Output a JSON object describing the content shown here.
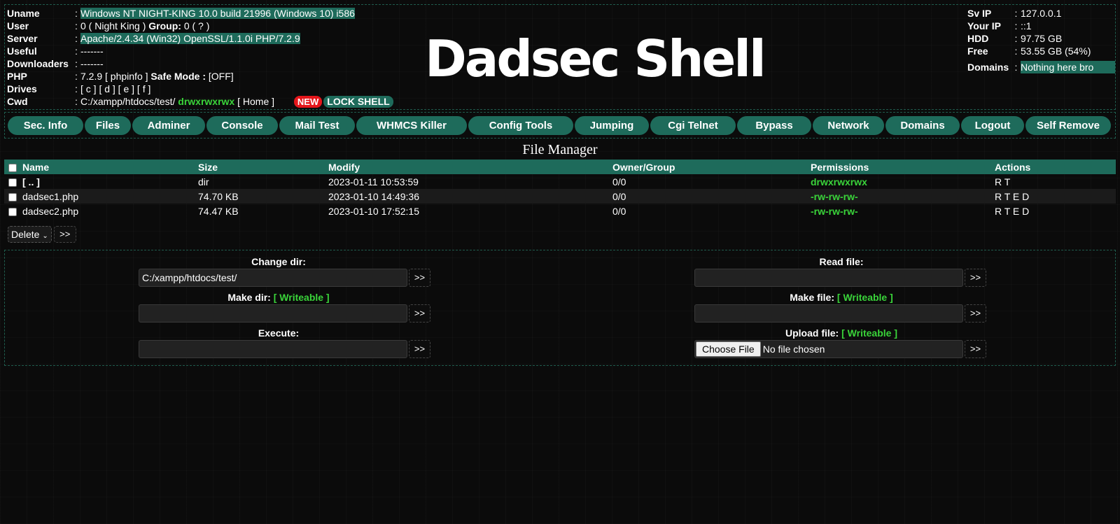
{
  "info": {
    "uname_label": "Uname",
    "uname_value": "Windows NT NIGHT-KING 10.0 build 21996 (Windows 10) i586",
    "user_label": "User",
    "user_id": "0 ( Night King )",
    "group_label": "Group:",
    "group_value": "0 ( ? )",
    "server_label": "Server",
    "server_value": "Apache/2.4.34 (Win32) OpenSSL/1.1.0i PHP/7.2.9",
    "useful_label": "Useful",
    "useful_value": "-------",
    "downloaders_label": "Downloaders",
    "downloaders_value": "-------",
    "php_label": "PHP",
    "php_value": "7.2.9 [ phpinfo ]",
    "safe_mode_label": "Safe Mode :",
    "safe_mode_value": "[OFF]",
    "drives_label": "Drives",
    "drives_value": "[ c ] [ d ] [ e ] [ f ]",
    "cwd_label": "Cwd",
    "cwd_path": "C:/xampp/htdocs/test/",
    "cwd_perms": "drwxrwxrwx",
    "cwd_home": "[ Home ]",
    "new_badge": "NEW",
    "lock_shell": "LOCK SHELL",
    "colon": ":"
  },
  "brand": "Dadsec Shell",
  "server_info": {
    "sv_ip_label": "Sv IP",
    "sv_ip": "127.0.0.1",
    "your_ip_label": "Your IP",
    "your_ip": "::1",
    "hdd_label": "HDD",
    "hdd": "97.75 GB",
    "free_label": "Free",
    "free": "53.55 GB (54%)",
    "domains_label": "Domains",
    "domains": "Nothing here bro"
  },
  "nav": [
    "Sec. Info",
    "Files",
    "Adminer",
    "Console",
    "Mail Test",
    "WHMCS Killer",
    "Config Tools",
    "Jumping",
    "Cgi Telnet",
    "Bypass",
    "Network",
    "Domains",
    "Logout",
    "Self Remove"
  ],
  "file_manager": {
    "title": "File Manager",
    "headers": {
      "name": "Name",
      "size": "Size",
      "modify": "Modify",
      "owner": "Owner/Group",
      "permissions": "Permissions",
      "actions": "Actions"
    },
    "rows": [
      {
        "name": "[ .. ]",
        "size": "dir",
        "modify": "2023-01-11 10:53:59",
        "owner": "0/0",
        "permissions": "drwxrwxrwx",
        "actions": "R T"
      },
      {
        "name": "dadsec1.php",
        "size": "74.70 KB",
        "modify": "2023-01-10 14:49:36",
        "owner": "0/0",
        "permissions": "-rw-rw-rw-",
        "actions": "R T E D"
      },
      {
        "name": "dadsec2.php",
        "size": "74.47 KB",
        "modify": "2023-01-10 17:52:15",
        "owner": "0/0",
        "permissions": "-rw-rw-rw-",
        "actions": "R T E D"
      }
    ],
    "bulk_action": "Delete",
    "go": ">>"
  },
  "tools": {
    "change_dir_label": "Change dir:",
    "change_dir_value": "C:/xampp/htdocs/test/",
    "read_file_label": "Read file:",
    "make_dir_label": "Make dir:",
    "make_file_label": "Make file:",
    "writeable": "[ Writeable ]",
    "execute_label": "Execute:",
    "upload_file_label": "Upload file:",
    "choose_file": "Choose File",
    "no_file": "No file chosen",
    "go": ">>"
  },
  "colors": {
    "accent": "#1e6b5b",
    "green": "#3ad43a",
    "red": "#e4161b"
  }
}
